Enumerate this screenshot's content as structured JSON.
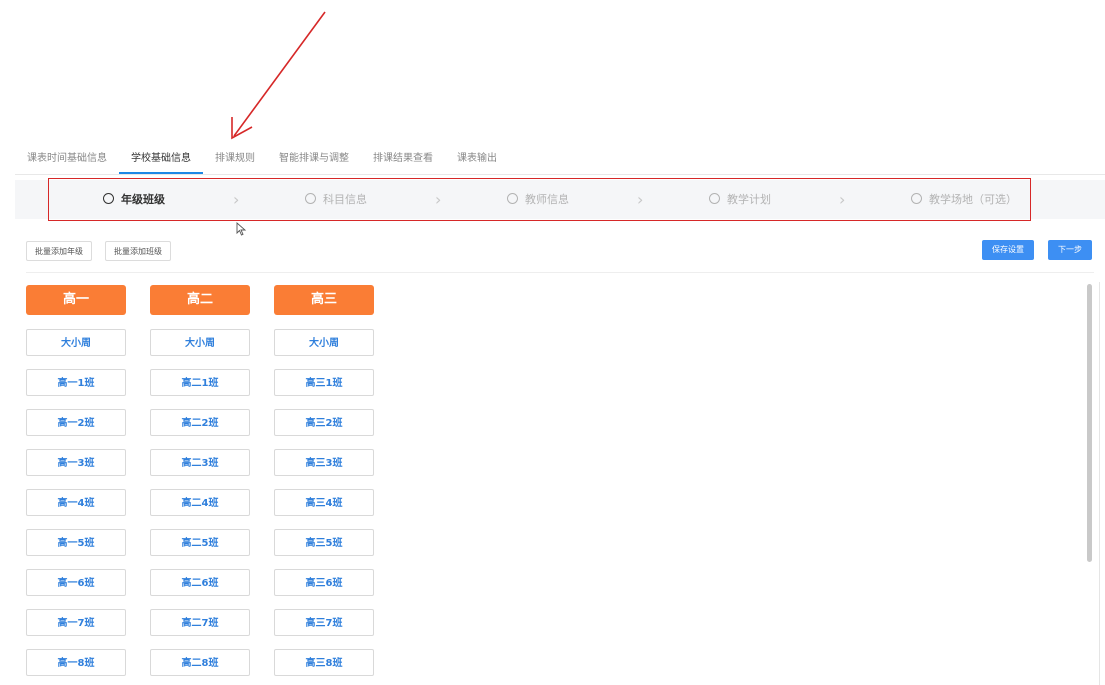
{
  "tabs": [
    {
      "label": "课表时间基础信息",
      "active": false
    },
    {
      "label": "学校基础信息",
      "active": true
    },
    {
      "label": "排课规则",
      "active": false
    },
    {
      "label": "智能排课与调整",
      "active": false
    },
    {
      "label": "排课结果查看",
      "active": false
    },
    {
      "label": "课表输出",
      "active": false
    }
  ],
  "steps": [
    {
      "label": "年级班级",
      "active": true
    },
    {
      "label": "科目信息",
      "active": false
    },
    {
      "label": "教师信息",
      "active": false
    },
    {
      "label": "教学计划",
      "active": false
    },
    {
      "label": "教学场地（可选）",
      "active": false
    }
  ],
  "actions": {
    "batch_add_grade": "批量添加年级",
    "batch_add_class": "批量添加班级",
    "save": "保存设置",
    "next": "下一步"
  },
  "colors": {
    "accent": "#3d8ff3",
    "grade_header": "#fa7d35",
    "class_text": "#2f7fdc",
    "annotation": "#d62828"
  },
  "grades": [
    {
      "name": "高一",
      "cells": [
        "大小周",
        "高一1班",
        "高一2班",
        "高一3班",
        "高一4班",
        "高一5班",
        "高一6班",
        "高一7班",
        "高一8班"
      ]
    },
    {
      "name": "高二",
      "cells": [
        "大小周",
        "高二1班",
        "高二2班",
        "高二3班",
        "高二4班",
        "高二5班",
        "高二6班",
        "高二7班",
        "高二8班"
      ]
    },
    {
      "name": "高三",
      "cells": [
        "大小周",
        "高三1班",
        "高三2班",
        "高三3班",
        "高三4班",
        "高三5班",
        "高三6班",
        "高三7班",
        "高三8班"
      ]
    }
  ]
}
